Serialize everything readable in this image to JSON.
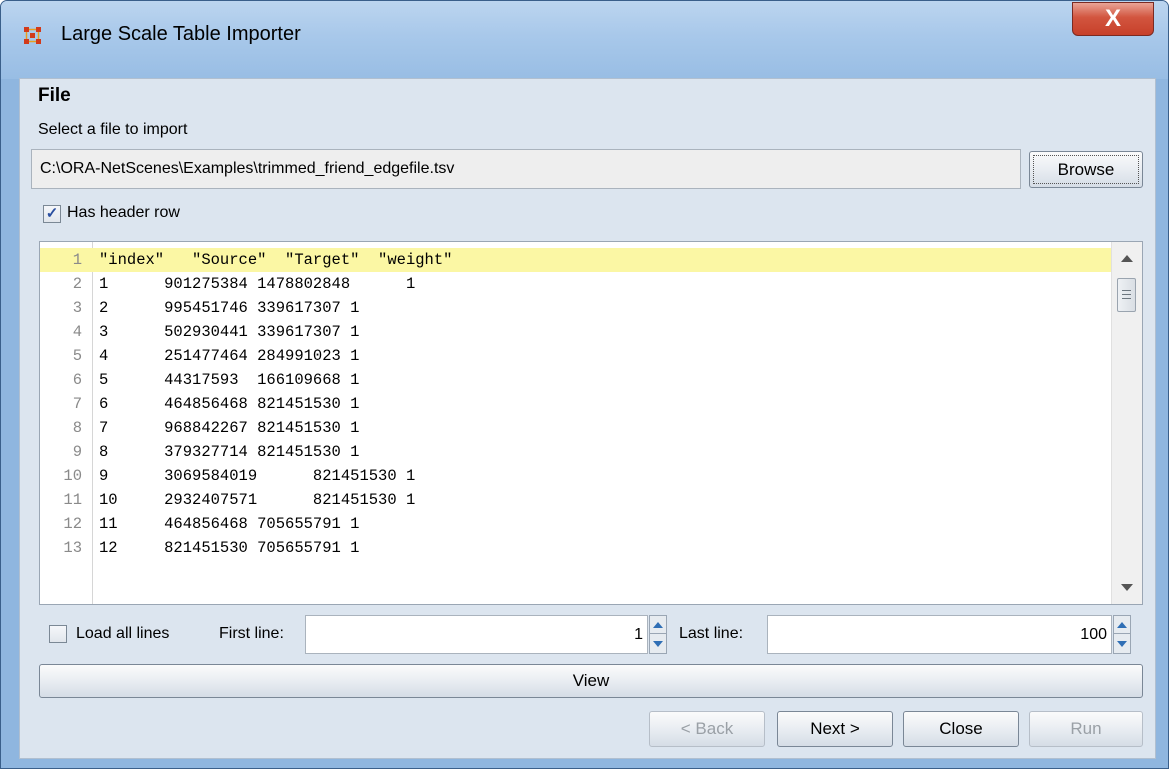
{
  "window": {
    "title": "Large Scale Table Importer",
    "close_glyph": "X"
  },
  "file_section": {
    "heading": "File",
    "select_label": "Select a file to import",
    "path_value": "C:\\ORA-NetScenes\\Examples\\trimmed_friend_edgefile.tsv",
    "browse_label": "Browse",
    "has_header_label": "Has header row",
    "has_header_checked": true
  },
  "preview": {
    "lines": [
      {
        "n": "1",
        "text": "\"index\"   \"Source\"  \"Target\"  \"weight\""
      },
      {
        "n": "2",
        "text": "1      901275384 1478802848      1"
      },
      {
        "n": "3",
        "text": "2      995451746 339617307 1"
      },
      {
        "n": "4",
        "text": "3      502930441 339617307 1"
      },
      {
        "n": "5",
        "text": "4      251477464 284991023 1"
      },
      {
        "n": "6",
        "text": "5      44317593  166109668 1"
      },
      {
        "n": "7",
        "text": "6      464856468 821451530 1"
      },
      {
        "n": "8",
        "text": "7      968842267 821451530 1"
      },
      {
        "n": "9",
        "text": "8      379327714 821451530 1"
      },
      {
        "n": "10",
        "text": "9      3069584019      821451530 1"
      },
      {
        "n": "11",
        "text": "10     2932407571      821451530 1"
      },
      {
        "n": "12",
        "text": "11     464856468 705655791 1"
      },
      {
        "n": "13",
        "text": "12     821451530 705655791 1"
      }
    ],
    "highlight_color": "#fbf7a4"
  },
  "range": {
    "load_all_label": "Load all lines",
    "load_all_checked": false,
    "first_label": "First line:",
    "first_value": "1",
    "last_label": "Last line:",
    "last_value": "100"
  },
  "buttons": {
    "view": "View",
    "back": "< Back",
    "next": "Next >",
    "close": "Close",
    "run": "Run"
  },
  "icons": {
    "app": "ora-app-icon",
    "window_close": "close-icon",
    "check": "checkmark-icon",
    "scroll_up": "scroll-up-arrow-icon",
    "scroll_down": "scroll-down-arrow-icon"
  }
}
